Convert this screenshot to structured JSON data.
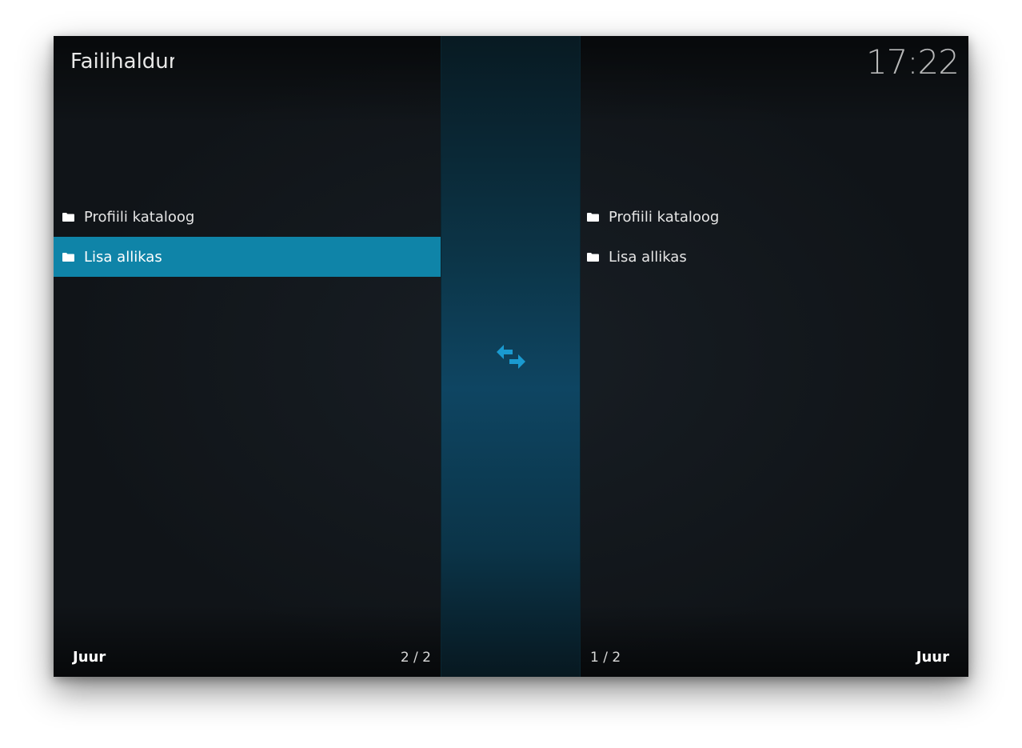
{
  "header": {
    "title": "Failihaldur",
    "clock": "17:22"
  },
  "left_pane": {
    "items": [
      {
        "label": "Profiili kataloog",
        "icon": "folder-icon",
        "selected": false
      },
      {
        "label": "Lisa allikas",
        "icon": "folder-icon",
        "selected": true
      }
    ],
    "footer_label": "Juur",
    "footer_count": "2 / 2"
  },
  "right_pane": {
    "items": [
      {
        "label": "Profiili kataloog",
        "icon": "folder-icon",
        "selected": false
      },
      {
        "label": "Lisa allikas",
        "icon": "folder-icon",
        "selected": false
      }
    ],
    "footer_label": "Juur",
    "footer_count": "1 / 2"
  },
  "middle": {
    "icon": "swap-arrows-icon"
  },
  "colors": {
    "accent": "#0f84a8",
    "swap_icon": "#1a9ad0",
    "background": "#101418"
  }
}
